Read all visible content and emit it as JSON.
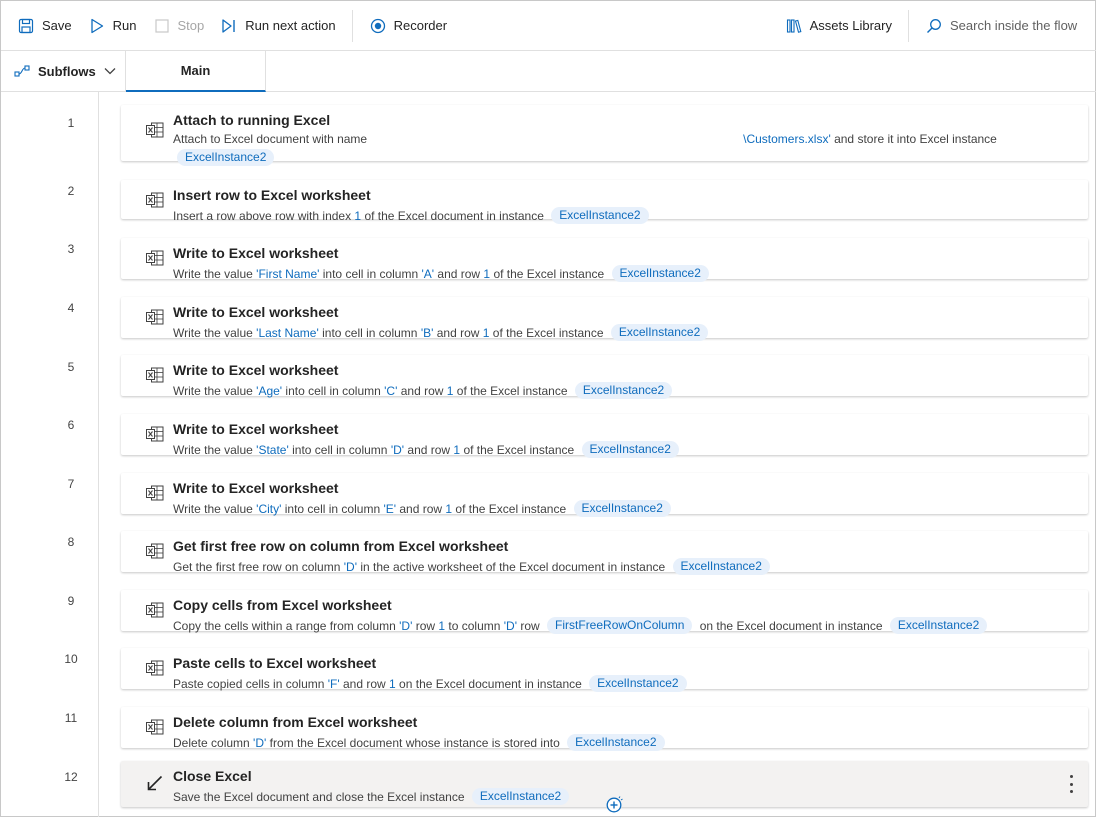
{
  "toolbar": {
    "save": "Save",
    "run": "Run",
    "stop": "Stop",
    "run_next": "Run next action",
    "recorder": "Recorder",
    "assets": "Assets Library",
    "search_placeholder": "Search inside the flow"
  },
  "tabs": {
    "subflows": "Subflows",
    "main": "Main"
  },
  "colors": {
    "accent": "#0f6cbd",
    "chip_bg": "#e7f0fb",
    "selected_row": "#f3f2f1"
  },
  "actions": [
    {
      "no": "1",
      "icon": "excel-icon",
      "title": "Attach to running Excel",
      "desc": {
        "t1": "Attach to Excel document with name",
        "v1": "\\Customers.xlsx'",
        "t2": " and store it into Excel instance",
        "chip": "ExcelInstance2"
      }
    },
    {
      "no": "2",
      "icon": "excel-icon",
      "title": "Insert row to Excel worksheet",
      "desc": {
        "t1": "Insert a row above row with index ",
        "v1": "1",
        "t2": " of the Excel document in instance ",
        "chip": "ExcelInstance2"
      }
    },
    {
      "no": "3",
      "icon": "excel-icon",
      "title": "Write to Excel worksheet",
      "desc": {
        "t1": "Write the value ",
        "v1": "'First Name'",
        "t2": " into cell in column ",
        "v2": "'A'",
        "t3": " and row ",
        "v3": "1",
        "t4": " of the Excel instance ",
        "chip": "ExcelInstance2"
      }
    },
    {
      "no": "4",
      "icon": "excel-icon",
      "title": "Write to Excel worksheet",
      "desc": {
        "t1": "Write the value ",
        "v1": "'Last Name'",
        "t2": " into cell in column ",
        "v2": "'B'",
        "t3": " and row ",
        "v3": "1",
        "t4": " of the Excel instance ",
        "chip": "ExcelInstance2"
      }
    },
    {
      "no": "5",
      "icon": "excel-icon",
      "title": "Write to Excel worksheet",
      "desc": {
        "t1": "Write the value ",
        "v1": "'Age'",
        "t2": " into cell in column ",
        "v2": "'C'",
        "t3": " and row ",
        "v3": "1",
        "t4": " of the Excel instance ",
        "chip": "ExcelInstance2"
      }
    },
    {
      "no": "6",
      "icon": "excel-icon",
      "title": "Write to Excel worksheet",
      "desc": {
        "t1": "Write the value ",
        "v1": "'State'",
        "t2": " into cell in column ",
        "v2": "'D'",
        "t3": " and row ",
        "v3": "1",
        "t4": " of the Excel instance ",
        "chip": "ExcelInstance2"
      }
    },
    {
      "no": "7",
      "icon": "excel-icon",
      "title": "Write to Excel worksheet",
      "desc": {
        "t1": "Write the value ",
        "v1": "'City'",
        "t2": " into cell in column ",
        "v2": "'E'",
        "t3": " and row ",
        "v3": "1",
        "t4": " of the Excel instance ",
        "chip": "ExcelInstance2"
      }
    },
    {
      "no": "8",
      "icon": "excel-icon",
      "title": "Get first free row on column from Excel worksheet",
      "desc": {
        "t1": "Get the first free row on column ",
        "v1": "'D'",
        "t2": " in the active worksheet of the Excel document in instance ",
        "chip": "ExcelInstance2"
      }
    },
    {
      "no": "9",
      "icon": "excel-icon",
      "title": "Copy cells from Excel worksheet",
      "desc": {
        "t1": "Copy the cells within a range from column ",
        "v1": "'D'",
        "t2": " row ",
        "v2": "1",
        "t3": " to column ",
        "v3": "'D'",
        "t4": " row ",
        "chip1": "FirstFreeRowOnColumn",
        "t5": " on the Excel document in instance ",
        "chip": "ExcelInstance2"
      }
    },
    {
      "no": "10",
      "icon": "excel-icon",
      "title": "Paste cells to Excel worksheet",
      "desc": {
        "t1": "Paste copied cells in column ",
        "v1": "'F'",
        "t2": " and row ",
        "v2": "1",
        "t3": " on the Excel document in instance ",
        "chip": "ExcelInstance2"
      }
    },
    {
      "no": "11",
      "icon": "excel-icon",
      "title": "Delete column from Excel worksheet",
      "desc": {
        "t1": "Delete column ",
        "v1": "'D'",
        "t2": " from the Excel document whose instance is stored into ",
        "chip": "ExcelInstance2"
      }
    },
    {
      "no": "12",
      "icon": "close-excel-icon",
      "title": "Close Excel",
      "desc": {
        "t1": "Save the Excel document and close the Excel instance ",
        "chip": "ExcelInstance2"
      }
    }
  ]
}
